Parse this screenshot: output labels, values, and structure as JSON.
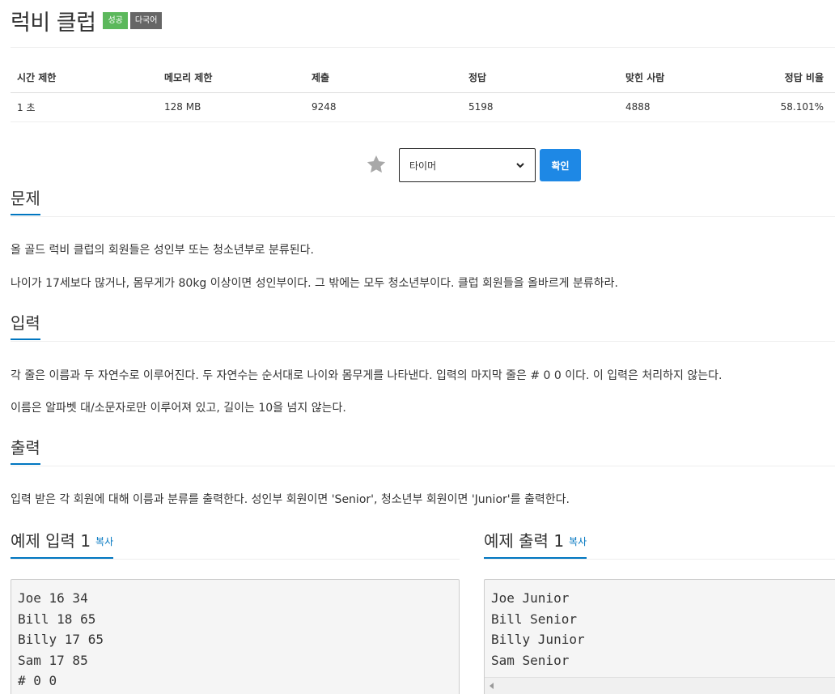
{
  "problem": {
    "title": "럭비 클럽",
    "badges": {
      "status": "성공",
      "lang": "다국어"
    }
  },
  "info_table": {
    "headers": [
      "시간 제한",
      "메모리 제한",
      "제출",
      "정답",
      "맞힌 사람",
      "정답 비율"
    ],
    "values": [
      "1 초",
      "128 MB",
      "9248",
      "5198",
      "4888",
      "58.101%"
    ]
  },
  "controls": {
    "select_value": "타이머",
    "confirm_label": "확인"
  },
  "sections": {
    "problem": {
      "heading": "문제",
      "paragraphs": [
        "올 골드 럭비 클럽의 회원들은 성인부 또는 청소년부로 분류된다.",
        "나이가 17세보다 많거나, 몸무게가 80kg 이상이면 성인부이다. 그 밖에는 모두 청소년부이다. 클럽 회원들을 올바르게 분류하라."
      ]
    },
    "input": {
      "heading": "입력",
      "paragraphs": [
        "각 줄은 이름과 두 자연수로 이루어진다. 두 자연수는 순서대로 나이와 몸무게를 나타낸다. 입력의 마지막 줄은 # 0 0 이다. 이 입력은 처리하지 않는다.",
        "이름은 알파벳 대/소문자로만 이루어져 있고, 길이는 10을 넘지 않는다."
      ]
    },
    "output": {
      "heading": "출력",
      "paragraphs": [
        "입력 받은 각 회원에 대해 이름과 분류를 출력한다. 성인부 회원이면 'Senior', 청소년부 회원이면 'Junior'를 출력한다."
      ]
    }
  },
  "samples": {
    "input_heading": "예제 입력 1",
    "output_heading": "예제 출력 1",
    "copy_label": "복사",
    "input_text": "Joe 16 34\nBill 18 65\nBilly 17 65\nSam 17 85\n# 0 0",
    "output_text": "Joe Junior\nBill Senior\nBilly Junior\nSam Senior"
  },
  "colors": {
    "success": "#5cb85c",
    "lang": "#666666",
    "accent": "#0076c0",
    "button": "#1e88e5"
  },
  "icons": {
    "star": "star-icon",
    "chevron": "chevron-down-icon"
  }
}
